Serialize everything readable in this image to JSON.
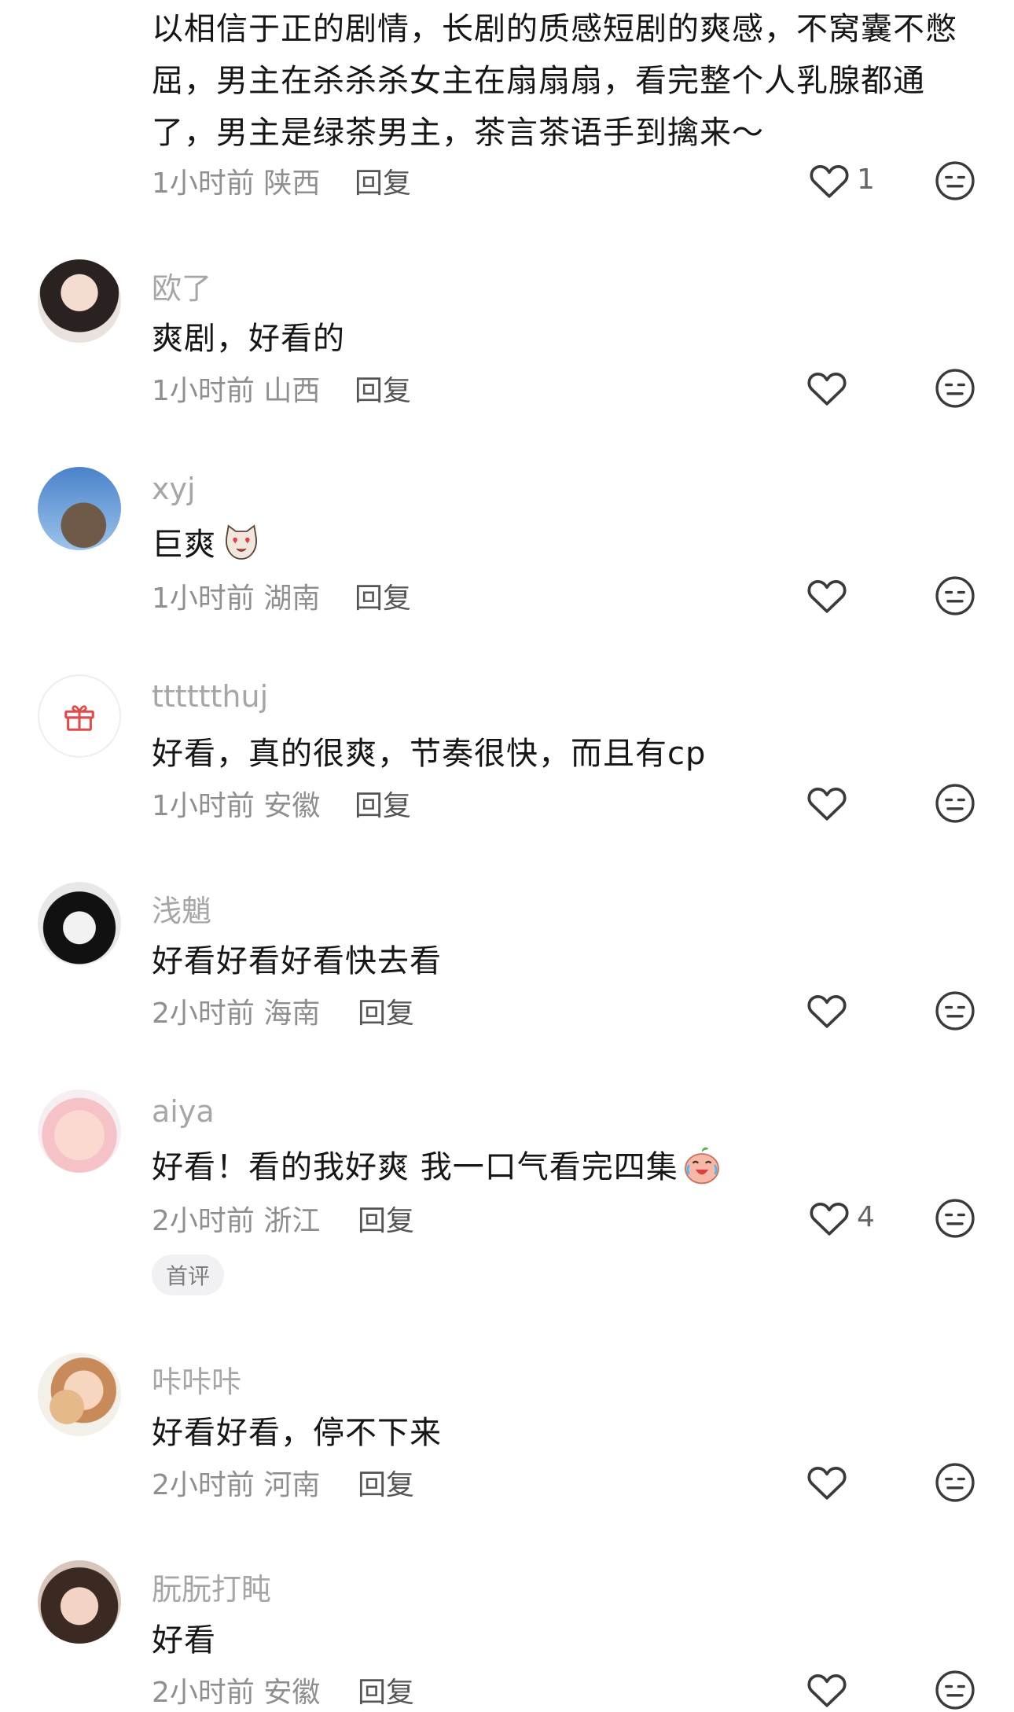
{
  "comments": [
    {
      "lines": [
        "以相信于正的剧情，长剧的质感短剧的爽感，不窝囊不憋",
        "屈，男主在杀杀杀女主在扇扇扇，看完整个人乳腺都通",
        "了，男主是绿茶男主，茶言茶语手到擒来～"
      ],
      "time": "1小时前",
      "region": "陕西",
      "reply": "回复",
      "likes": "1"
    },
    {
      "name": "欧了",
      "text": "爽剧，好看的",
      "time": "1小时前",
      "region": "山西",
      "reply": "回复",
      "likes": ""
    },
    {
      "name": "xyj",
      "text": "巨爽",
      "time": "1小时前",
      "region": "湖南",
      "reply": "回复",
      "likes": ""
    },
    {
      "name": "tttttthuj",
      "text": "好看，真的很爽，节奏很快，而且有cp",
      "time": "1小时前",
      "region": "安徽",
      "reply": "回复",
      "likes": ""
    },
    {
      "name": "浅魈",
      "text": "好看好看好看快去看",
      "time": "2小时前",
      "region": "海南",
      "reply": "回复",
      "likes": ""
    },
    {
      "name": "aiya",
      "text": "好看！看的我好爽 我一口气看完四集",
      "time": "2小时前",
      "region": "浙江",
      "reply": "回复",
      "likes": "4",
      "badge": "首评"
    },
    {
      "name": "咔咔咔",
      "text": "好看好看，停不下来",
      "time": "2小时前",
      "region": "河南",
      "reply": "回复",
      "likes": ""
    },
    {
      "name": "朊朊打盹",
      "text": "好看",
      "time": "2小时前",
      "region": "安徽",
      "reply": "回复",
      "likes": ""
    }
  ],
  "icons": {
    "like": "heart-outline-icon",
    "reaction": "neutral-face-icon",
    "gift": "gift-box-icon"
  },
  "colors": {
    "text": "#161616",
    "name": "#a6a6a6",
    "meta": "#8f8f8f",
    "icon": "#3a3a3a",
    "gift": "#e24a4a"
  }
}
